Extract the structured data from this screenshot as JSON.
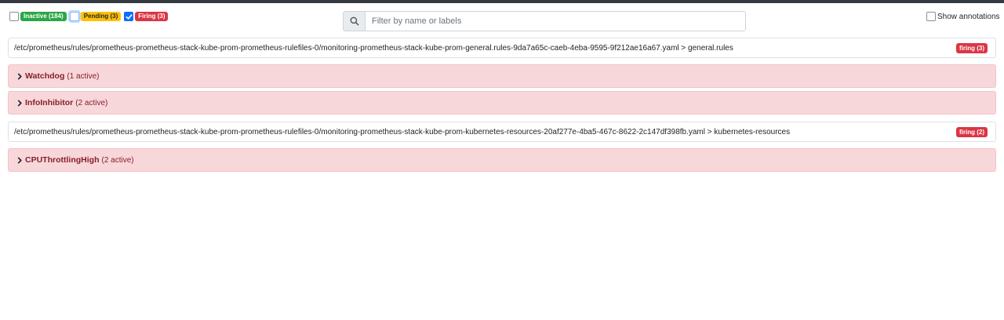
{
  "filters": {
    "inactive": {
      "label": "Inactive (184)",
      "checked": false
    },
    "pending": {
      "label": "Pending (3)",
      "checked": false
    },
    "firing": {
      "label": "Firing (3)",
      "checked": true
    }
  },
  "search": {
    "placeholder": "Filter by name or labels",
    "value": ""
  },
  "annotations": {
    "label": "Show annotations",
    "checked": false
  },
  "groups": [
    {
      "file": "/etc/prometheus/rules/prometheus-prometheus-stack-kube-prom-prometheus-rulefiles-0/monitoring-prometheus-stack-kube-prom-general.rules-9da7a65c-caeb-4eba-9595-9f212ae16a67.yaml > general.rules",
      "badge": "firing (3)",
      "alerts": [
        {
          "name": "Watchdog",
          "count": "(1 active)"
        },
        {
          "name": "InfoInhibitor",
          "count": "(2 active)"
        }
      ]
    },
    {
      "file": "/etc/prometheus/rules/prometheus-prometheus-stack-kube-prom-prometheus-rulefiles-0/monitoring-prometheus-stack-kube-prom-kubernetes-resources-20af277e-4ba5-467c-8622-2c147df398fb.yaml > kubernetes-resources",
      "badge": "firing (2)",
      "alerts": [
        {
          "name": "CPUThrottlingHigh",
          "count": "(2 active)"
        }
      ]
    }
  ],
  "colors": {
    "inactive": "#28a745",
    "pending": "#ffc107",
    "firing": "#dc3545",
    "alert_bg": "#f8d7da",
    "alert_text": "#842029"
  }
}
